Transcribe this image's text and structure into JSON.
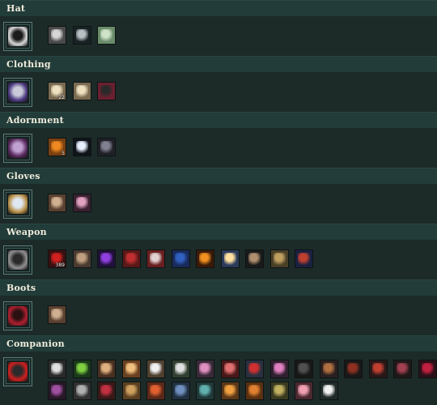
{
  "sections": [
    {
      "title": "Hat",
      "slot_icon": "hat-silhouette-icon",
      "slot_colors": [
        "#d9d9d9",
        "#1a1a1a"
      ],
      "items": [
        {
          "icon": "cat-mask-icon",
          "bg": "#4a4a4a",
          "fg": "#d6d6d6",
          "qty": ""
        },
        {
          "icon": "dark-streak-icon",
          "bg": "#182224",
          "fg": "#b8c0c4",
          "qty": ""
        },
        {
          "icon": "green-face-icon",
          "bg": "#6a8c6a",
          "fg": "#cfe3c8",
          "qty": ""
        }
      ]
    },
    {
      "title": "Clothing",
      "slot_icon": "robe-silhouette-icon",
      "slot_colors": [
        "#4d3a80",
        "#c9c9d9"
      ],
      "items": [
        {
          "icon": "tan-armor-icon",
          "bg": "#7a6a50",
          "fg": "#efe0c0",
          "qty": "22"
        },
        {
          "icon": "tan-armor-icon",
          "bg": "#7a6a50",
          "fg": "#efe0c0",
          "qty": ""
        },
        {
          "icon": "red-dark-armor-icon",
          "bg": "#6a2030",
          "fg": "#2a2a2a",
          "qty": ""
        }
      ]
    },
    {
      "title": "Adornment",
      "slot_icon": "purple-swirl-icon",
      "slot_colors": [
        "#5a2a60",
        "#c0a0d0"
      ],
      "items": [
        {
          "icon": "orange-pot-icon",
          "bg": "#7a4010",
          "fg": "#f08a20",
          "qty": "5"
        },
        {
          "icon": "sparkle-star-icon",
          "bg": "#10141a",
          "fg": "#e8f0ff",
          "qty": ""
        },
        {
          "icon": "dark-creature-icon",
          "bg": "#202028",
          "fg": "#808090",
          "qty": ""
        }
      ]
    },
    {
      "title": "Gloves",
      "slot_icon": "mirror-frame-icon",
      "slot_colors": [
        "#b89048",
        "#dfe8f0"
      ],
      "items": [
        {
          "icon": "brown-rune-icon",
          "bg": "#5a4030",
          "fg": "#d0b090",
          "qty": ""
        },
        {
          "icon": "pink-flask-icon",
          "bg": "#3a2030",
          "fg": "#e0a0c0",
          "qty": ""
        }
      ]
    },
    {
      "title": "Weapon",
      "slot_icon": "bin-bucket-icon",
      "slot_colors": [
        "#909090",
        "#2a2a2a"
      ],
      "items": [
        {
          "icon": "red-shard-icon",
          "bg": "#3a1010",
          "fg": "#d02020",
          "qty": "389"
        },
        {
          "icon": "brown-wand-icon",
          "bg": "#4a3a30",
          "fg": "#c0a080",
          "qty": ""
        },
        {
          "icon": "purple-crystal-icon",
          "bg": "#20103a",
          "fg": "#9040e0",
          "qty": ""
        },
        {
          "icon": "red-book-icon",
          "bg": "#5a1818",
          "fg": "#c03030",
          "qty": ""
        },
        {
          "icon": "crossed-blades-icon",
          "bg": "#6a2020",
          "fg": "#e0d0d0",
          "qty": ""
        },
        {
          "icon": "blue-book-icon",
          "bg": "#182a5a",
          "fg": "#3060c0",
          "qty": ""
        },
        {
          "icon": "explosion-icon",
          "bg": "#3a1a08",
          "fg": "#f09020",
          "qty": ""
        },
        {
          "icon": "torch-light-icon",
          "bg": "#2a3a5a",
          "fg": "#ffe0a0",
          "qty": ""
        },
        {
          "icon": "pickaxe-icon",
          "bg": "#1a1a1a",
          "fg": "#b09070",
          "qty": ""
        },
        {
          "icon": "tan-tome-icon",
          "bg": "#4a4028",
          "fg": "#c0a060",
          "qty": ""
        },
        {
          "icon": "red-tome-icon",
          "bg": "#1a2040",
          "fg": "#c04030",
          "qty": ""
        }
      ]
    },
    {
      "title": "Boots",
      "slot_icon": "red-boot-icon",
      "slot_colors": [
        "#b02030",
        "#2a1010"
      ],
      "items": [
        {
          "icon": "brown-rune-icon",
          "bg": "#5a4030",
          "fg": "#d0b090",
          "qty": ""
        }
      ]
    },
    {
      "title": "Companion",
      "slot_icon": "red-bird-icon",
      "slot_colors": [
        "#d02020",
        "#2a2a2a"
      ],
      "items": [
        {
          "icon": "panda-pet-icon",
          "bg": "#2a2a2a",
          "fg": "#e0e0e0",
          "qty": ""
        },
        {
          "icon": "green-dragon-pet-icon",
          "bg": "#1a3a1a",
          "fg": "#80d040",
          "qty": ""
        },
        {
          "icon": "fox-pet-icon",
          "bg": "#4a3020",
          "fg": "#e0b080",
          "qty": ""
        },
        {
          "icon": "lion-pet-icon",
          "bg": "#6a4020",
          "fg": "#f0c080",
          "qty": ""
        },
        {
          "icon": "white-ghost-pet-icon",
          "bg": "#504030",
          "fg": "#f0f0f0",
          "qty": ""
        },
        {
          "icon": "black-bird-pet-icon",
          "bg": "#304030",
          "fg": "#e0e0e0",
          "qty": ""
        },
        {
          "icon": "pink-bunny-pet-icon",
          "bg": "#3a2a3a",
          "fg": "#e090c0",
          "qty": ""
        },
        {
          "icon": "red-imp-pet-icon",
          "bg": "#4a1818",
          "fg": "#e07070",
          "qty": ""
        },
        {
          "icon": "red-bird-pet-icon",
          "bg": "#2a3040",
          "fg": "#d03030",
          "qty": ""
        },
        {
          "icon": "pink-snake-pet-icon",
          "bg": "#302030",
          "fg": "#e080c0",
          "qty": ""
        },
        {
          "icon": "black-crow-pet-icon",
          "bg": "#181818",
          "fg": "#505050",
          "qty": ""
        },
        {
          "icon": "brown-hawk-pet-icon",
          "bg": "#2a2020",
          "fg": "#b07040",
          "qty": ""
        },
        {
          "icon": "dark-bat-pet-icon",
          "bg": "#1a1818",
          "fg": "#903020",
          "qty": ""
        },
        {
          "icon": "red-dragon-pet-icon",
          "bg": "#2a1818",
          "fg": "#c04030",
          "qty": ""
        },
        {
          "icon": "horned-demon-pet-icon",
          "bg": "#201818",
          "fg": "#a04050",
          "qty": ""
        },
        {
          "icon": "crimson-beast-pet-icon",
          "bg": "#2a1018",
          "fg": "#c02040",
          "qty": ""
        },
        {
          "icon": "purple-wolf-pet-icon",
          "bg": "#281828",
          "fg": "#a050a0",
          "qty": ""
        },
        {
          "icon": "grey-dragon-pet-icon",
          "bg": "#303030",
          "fg": "#b0b0b0",
          "qty": ""
        },
        {
          "icon": "crimson-hydra-pet-icon",
          "bg": "#3a1818",
          "fg": "#c03040",
          "qty": ""
        },
        {
          "icon": "tan-monkey-pet-icon",
          "bg": "#5a4020",
          "fg": "#d0a060",
          "qty": ""
        },
        {
          "icon": "red-fox-pet-icon",
          "bg": "#5a2818",
          "fg": "#e06030",
          "qty": ""
        },
        {
          "icon": "blue-owl-pet-icon",
          "bg": "#203040",
          "fg": "#7090c0",
          "qty": ""
        },
        {
          "icon": "teal-cat-pet-icon",
          "bg": "#203838",
          "fg": "#60b0b0",
          "qty": ""
        },
        {
          "icon": "orange-kitten-pet-icon",
          "bg": "#5a3818",
          "fg": "#f0a040",
          "qty": ""
        },
        {
          "icon": "ginger-cat-pet-icon",
          "bg": "#5a3010",
          "fg": "#e08030",
          "qty": ""
        },
        {
          "icon": "olive-goblin-pet-icon",
          "bg": "#3a3a20",
          "fg": "#c0b060",
          "qty": ""
        },
        {
          "icon": "pink-pig-pet-icon",
          "bg": "#4a2830",
          "fg": "#f0a0b0",
          "qty": ""
        },
        {
          "icon": "magpie-pet-icon",
          "bg": "#202a28",
          "fg": "#f0f0f0",
          "qty": ""
        }
      ]
    }
  ]
}
